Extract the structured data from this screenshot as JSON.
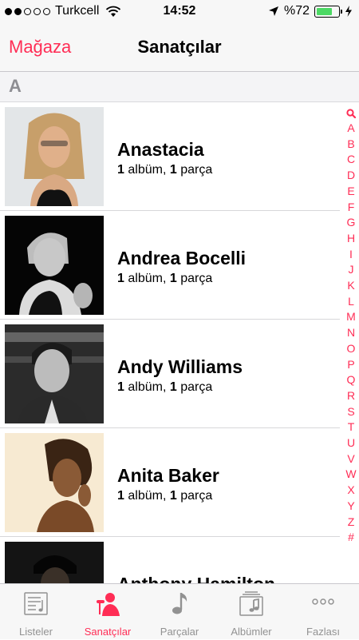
{
  "status_bar": {
    "carrier": "Turkcell",
    "time": "14:52",
    "battery_percent": "%72",
    "battery_level": 0.72,
    "signal_bars": 2
  },
  "nav": {
    "back_label": "Mağaza",
    "title": "Sanatçılar"
  },
  "section": {
    "letter": "A"
  },
  "artists": [
    {
      "name": "Anastacia",
      "album_count": "1",
      "album_word": "albüm,",
      "track_count": "1",
      "track_word": "parça"
    },
    {
      "name": "Andrea Bocelli",
      "album_count": "1",
      "album_word": "albüm,",
      "track_count": "1",
      "track_word": "parça"
    },
    {
      "name": "Andy Williams",
      "album_count": "1",
      "album_word": "albüm,",
      "track_count": "1",
      "track_word": "parça"
    },
    {
      "name": "Anita Baker",
      "album_count": "1",
      "album_word": "albüm,",
      "track_count": "1",
      "track_word": "parça"
    },
    {
      "name": "Anthony Hamilton"
    }
  ],
  "index_letters": [
    "A",
    "B",
    "C",
    "D",
    "E",
    "F",
    "G",
    "H",
    "I",
    "J",
    "K",
    "L",
    "M",
    "N",
    "O",
    "P",
    "Q",
    "R",
    "S",
    "T",
    "U",
    "V",
    "W",
    "X",
    "Y",
    "Z",
    "#"
  ],
  "tabs": [
    {
      "label": "Listeler",
      "icon": "playlist-icon",
      "active": false
    },
    {
      "label": "Sanatçılar",
      "icon": "microphone-artist-icon",
      "active": true
    },
    {
      "label": "Parçalar",
      "icon": "music-note-icon",
      "active": false
    },
    {
      "label": "Albümler",
      "icon": "album-stack-icon",
      "active": false
    },
    {
      "label": "Fazlası",
      "icon": "more-dots-icon",
      "active": false
    }
  ],
  "colors": {
    "accent": "#ff2d55",
    "battery": "#4cd964",
    "inactive_tab": "#929292"
  }
}
